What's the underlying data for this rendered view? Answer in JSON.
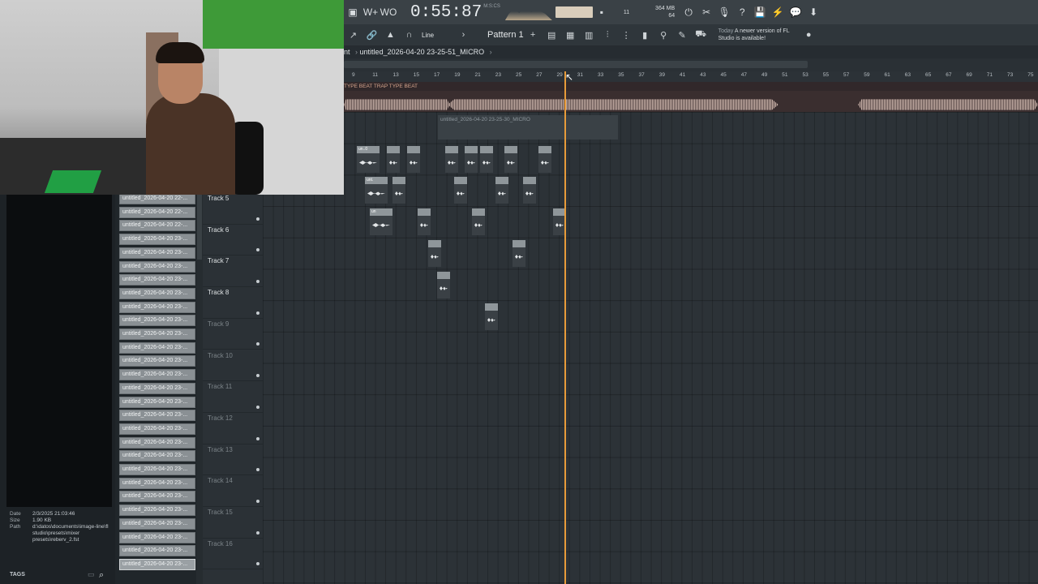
{
  "toolbar": {
    "time": "0:55:87",
    "time_unit": "M:S:CS",
    "step_num": "11",
    "mem_top": "364 MB",
    "mem_bottom": "64"
  },
  "toolbar2": {
    "snap": "Line",
    "pattern": "Pattern 1",
    "news_today": "Today",
    "news_text": "A newer version of FL Studio is available!"
  },
  "titlebar": {
    "prefix": "nt",
    "project": "untitled_2026-04-20 23-25-51_MICRO"
  },
  "ruler": {
    "ticks": [
      "9",
      "11",
      "13",
      "15",
      "17",
      "19",
      "21",
      "23",
      "25",
      "27",
      "29",
      "31",
      "33",
      "35",
      "37",
      "39",
      "41",
      "43",
      "45",
      "47",
      "49",
      "51",
      "53",
      "55",
      "57",
      "59",
      "61",
      "63",
      "65",
      "67",
      "69",
      "71",
      "73",
      "75"
    ]
  },
  "marker_text": "TYPE BEAT  TRAP TYPE BEAT",
  "playlist": {
    "recording_clip": "untitled_2026-04-20 23-25-30_MICRO"
  },
  "clip_labels": {
    "a": "un..0",
    "b": "unt.",
    "c": "un"
  },
  "tracks": [
    {
      "name": "Track 5",
      "active": true
    },
    {
      "name": "Track 6",
      "active": true
    },
    {
      "name": "Track 7",
      "active": true
    },
    {
      "name": "Track 8",
      "active": true
    },
    {
      "name": "Track 9",
      "active": false
    },
    {
      "name": "Track 10",
      "active": false
    },
    {
      "name": "Track 11",
      "active": false
    },
    {
      "name": "Track 12",
      "active": false
    },
    {
      "name": "Track 13",
      "active": false
    },
    {
      "name": "Track 14",
      "active": false
    },
    {
      "name": "Track 15",
      "active": false
    },
    {
      "name": "Track 16",
      "active": false
    }
  ],
  "clips": [
    "untitled_2026-04-20 22-...",
    "untitled_2026-04-20 22-...",
    "untitled_2026-04-20 22-...",
    "untitled_2026-04-20 23-...",
    "untitled_2026-04-20 23-...",
    "untitled_2026-04-20 23-...",
    "untitled_2026-04-20 23-...",
    "untitled_2026-04-20 23-...",
    "untitled_2026-04-20 23-...",
    "untitled_2026-04-20 23-...",
    "untitled_2026-04-20 23-...",
    "untitled_2026-04-20 23-...",
    "untitled_2026-04-20 23-...",
    "untitled_2026-04-20 23-...",
    "untitled_2026-04-20 23-...",
    "untitled_2026-04-20 23-...",
    "untitled_2026-04-20 23-...",
    "untitled_2026-04-20 23-...",
    "untitled_2026-04-20 23-...",
    "untitled_2026-04-20 23-...",
    "untitled_2026-04-20 23-...",
    "untitled_2026-04-20 23-...",
    "untitled_2026-04-20 23-...",
    "untitled_2026-04-20 23-...",
    "untitled_2026-04-20 23-...",
    "untitled_2026-04-20 23-...",
    "untitled_2026-04-20 23-...",
    "untitled_2026-04-20 23-..."
  ],
  "info": {
    "date_label": "Date",
    "date": "2/3/2025 21:03:46",
    "size_label": "Size",
    "size": "1.90 KB",
    "path_label": "Path",
    "path": "d:\\datos\\documents\\image-line\\fl studio\\presets\\mixer presets\\reberv_2.fst"
  },
  "tags_label": "TAGS",
  "colors": {
    "playhead": "#e79b3a",
    "accent_wave": "#c9b2a9"
  }
}
